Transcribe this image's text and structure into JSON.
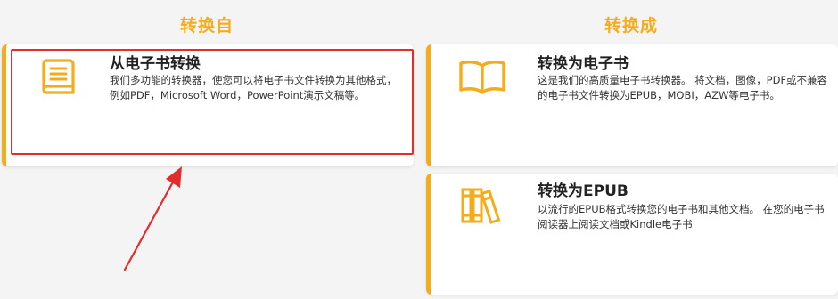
{
  "columns": {
    "left_title": "转换自",
    "right_title": "转换成"
  },
  "cards": {
    "from_ebook": {
      "title": "从电子书转换",
      "desc": "我们多功能的转换器，使您可以将电子书文件转换为其他格式，例如PDF，Microsoft Word，PowerPoint演示文稿等。",
      "icon": "book-icon"
    },
    "to_ebook": {
      "title": "转换为电子书",
      "desc": "这是我们的高质量电子书转换器。 将文档，图像，PDF或不兼容的电子书文件转换为EPUB，MOBI，AZW等电子书。",
      "icon": "open-book-icon"
    },
    "to_epub": {
      "title": "转换为EPUB",
      "desc": "以流行的EPUB格式转换您的电子书和其他文档。 在您的电子书阅读器上阅读文档或Kindle电子书",
      "icon": "books-icon"
    }
  },
  "colors": {
    "accent": "#f5ac1b",
    "highlight": "#e22d2d"
  }
}
